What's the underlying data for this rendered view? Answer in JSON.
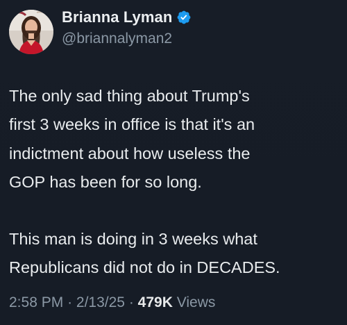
{
  "author": {
    "display_name": "Brianna Lyman",
    "handle": "@briannalyman2",
    "verified": true,
    "verified_color": "#1d9bf0"
  },
  "tweet": {
    "paragraphs": [
      [
        "The only sad thing about Trump's",
        "first 3 weeks in office is that it's an",
        "indictment about how useless the",
        "GOP has been for so long."
      ],
      [
        "This man is doing in 3 weeks what",
        "Republicans did not do in DECADES."
      ]
    ]
  },
  "meta": {
    "time": "2:58 PM",
    "separator": "·",
    "date": "2/13/25",
    "views_count": "479K",
    "views_label": "Views"
  },
  "colors": {
    "background": "#171d27",
    "text_primary": "#e7e9ea",
    "text_secondary": "#8b98a5"
  }
}
